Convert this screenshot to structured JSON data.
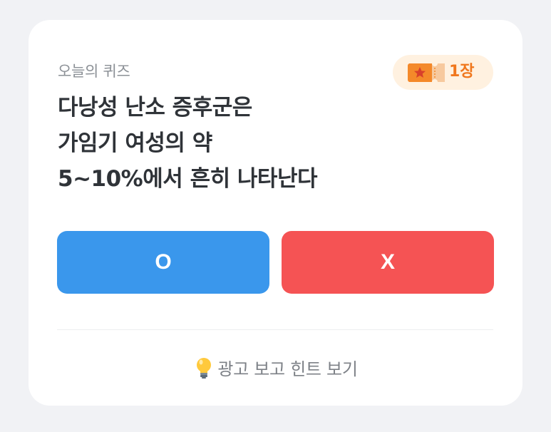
{
  "quiz": {
    "label": "오늘의 퀴즈",
    "ticket_count": "1장",
    "question_lines": [
      "다낭성 난소 증후군은",
      "가임기 여성의 약",
      "5~10%에서 흔히 나타난다"
    ]
  },
  "answers": {
    "o_label": "O",
    "x_label": "X"
  },
  "hint": {
    "label": "광고 보고 힌트 보기",
    "icon": "lightbulb-icon"
  },
  "colors": {
    "background": "#f1f2f5",
    "card": "#ffffff",
    "o_button": "#3a97ec",
    "x_button": "#f55354",
    "ticket_accent": "#f0771d",
    "ticket_badge_bg": "#fff1e0"
  }
}
